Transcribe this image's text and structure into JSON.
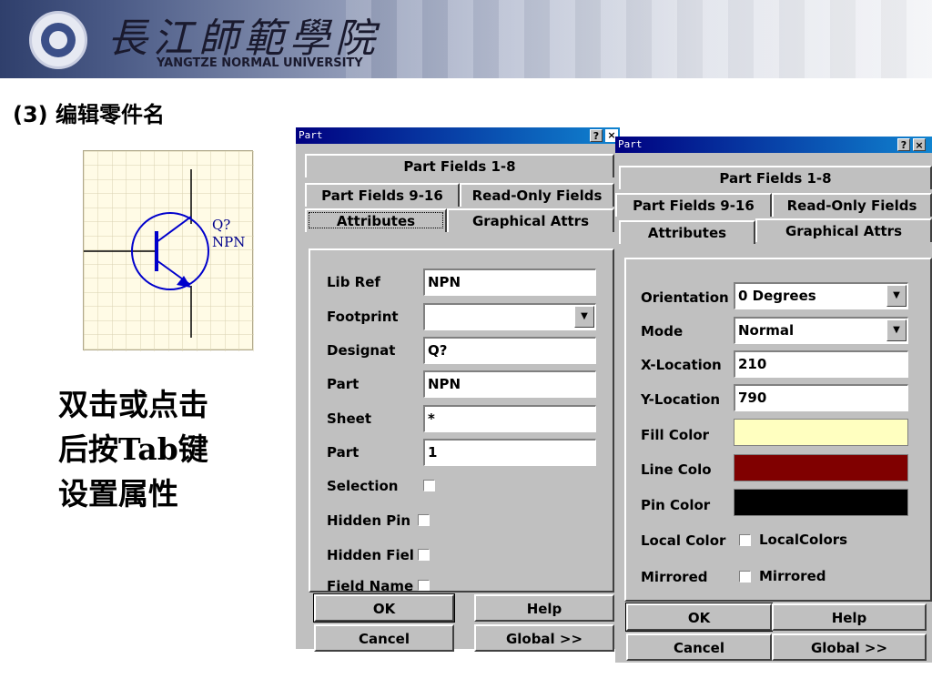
{
  "header": {
    "school_name_cn": "長江師範學院",
    "school_name_en": "YANGTZE NORMAL UNIVERSITY"
  },
  "step_title": "(3) 编辑零件名",
  "schematic": {
    "designator": "Q?",
    "part_type": "NPN"
  },
  "instructions": [
    "双击或点击",
    "后按Tab键",
    "设置属性"
  ],
  "dialog_left": {
    "title": "Part",
    "help_btn": "?",
    "close_btn": "×",
    "tabs": [
      "Part Fields 1-8",
      "Part Fields 9-16",
      "Read-Only Fields",
      "Attributes",
      "Graphical Attrs"
    ],
    "active_tab": "Attributes",
    "fields": {
      "lib_ref": {
        "label": "Lib Ref",
        "value": "NPN"
      },
      "footprint": {
        "label": "Footprint",
        "value": ""
      },
      "designator": {
        "label": "Designat",
        "value": "Q?"
      },
      "part": {
        "label": "Part",
        "value": "NPN"
      },
      "sheet": {
        "label": "Sheet",
        "value": "*"
      },
      "part2": {
        "label": "Part",
        "value": "1"
      }
    },
    "checks": {
      "selection": "Selection",
      "hidden_pins": "Hidden Pin",
      "hidden_fields": "Hidden Fiel",
      "field_names": "Field Name"
    },
    "buttons": {
      "ok": "OK",
      "help": "Help",
      "cancel": "Cancel",
      "global": "Global >>"
    }
  },
  "dialog_right": {
    "title": "Part",
    "help_btn": "?",
    "close_btn": "×",
    "tabs": [
      "Part Fields 1-8",
      "Part Fields 9-16",
      "Read-Only Fields",
      "Attributes",
      "Graphical Attrs"
    ],
    "active_tab": "Graphical Attrs",
    "fields": {
      "orientation": {
        "label": "Orientation",
        "value": "0 Degrees"
      },
      "mode": {
        "label": "Mode",
        "value": "Normal"
      },
      "x_location": {
        "label": "X-Location",
        "value": "210"
      },
      "y_location": {
        "label": "Y-Location",
        "value": "790"
      }
    },
    "colors": {
      "fill": {
        "label": "Fill Color",
        "value": "#ffffc0"
      },
      "line": {
        "label": "Line Colo",
        "value": "#800000"
      },
      "pin": {
        "label": "Pin Color",
        "value": "#000000"
      }
    },
    "checks": {
      "local_color": {
        "label": "Local Color",
        "text": "LocalColors"
      },
      "mirrored": {
        "label": "Mirrored",
        "text": "Mirrored"
      }
    },
    "buttons": {
      "ok": "OK",
      "help": "Help",
      "cancel": "Cancel",
      "global": "Global >>"
    }
  }
}
